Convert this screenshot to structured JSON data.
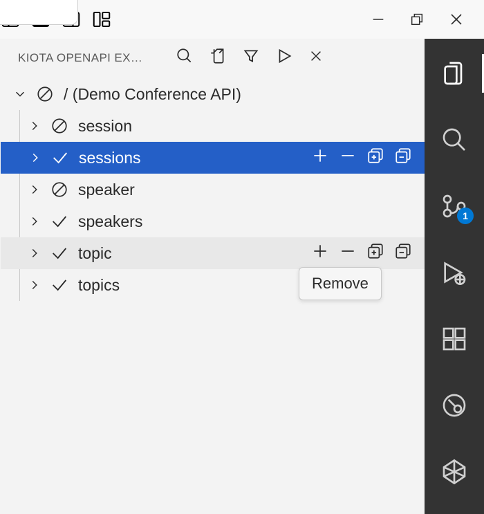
{
  "panel": {
    "title": "KIOTA OPENAPI EX…"
  },
  "tree": {
    "root": {
      "label": "/ (Demo Conference API)"
    },
    "items": [
      {
        "label": "session",
        "status": "excluded",
        "selected": false,
        "hover": false
      },
      {
        "label": "sessions",
        "status": "included",
        "selected": true,
        "hover": false
      },
      {
        "label": "speaker",
        "status": "excluded",
        "selected": false,
        "hover": false
      },
      {
        "label": "speakers",
        "status": "included",
        "selected": false,
        "hover": false
      },
      {
        "label": "topic",
        "status": "included",
        "selected": false,
        "hover": true
      },
      {
        "label": "topics",
        "status": "included",
        "selected": false,
        "hover": false
      }
    ]
  },
  "tooltip": {
    "text": "Remove"
  },
  "activitybar": {
    "sc_badge": "1"
  }
}
